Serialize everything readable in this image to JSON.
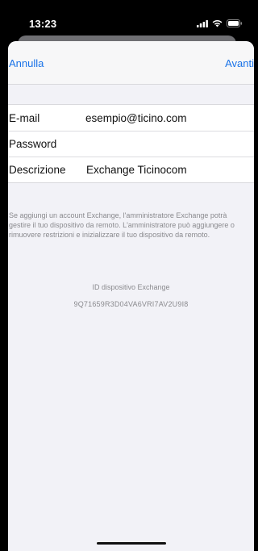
{
  "status_bar": {
    "time": "13:23",
    "icons": [
      "signal-icon",
      "wifi-icon",
      "battery-icon"
    ]
  },
  "nav": {
    "cancel_label": "Annulla",
    "next_label": "Avanti",
    "accent_color": "#1a73e8"
  },
  "form": {
    "rows": [
      {
        "label": "E-mail",
        "value": "esempio@ticino.com"
      },
      {
        "label": "Password",
        "value": ""
      },
      {
        "label": "Descrizione",
        "value": "Exchange Ticinocom"
      }
    ]
  },
  "footer": {
    "notice": "Se aggiungi un account Exchange, l'amministratore Exchange potrà gestire il tuo dispositivo da remoto. L'amministratore può aggiungere o rimuovere restrizioni e inizializzare il tuo dispositivo da remoto.",
    "device_id_label": "ID dispositivo Exchange",
    "device_id": "9Q71659R3D04VA6VRI7AV2U9I8"
  }
}
